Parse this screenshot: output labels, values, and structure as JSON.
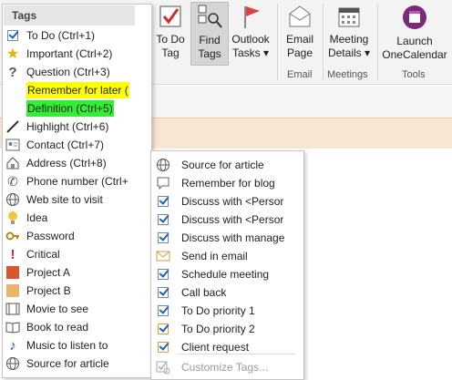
{
  "ribbon": {
    "buttons": [
      {
        "name": "todo-tag-button",
        "label1": "To Do",
        "label2": "Tag",
        "icon": "red-checkbox-icon"
      },
      {
        "name": "find-tags-button",
        "label1": "Find",
        "label2": "Tags",
        "icon": "find-tags-icon"
      },
      {
        "name": "outlook-tasks-button",
        "label1": "Outlook",
        "label2": "Tasks ▾",
        "icon": "red-flag-icon"
      },
      {
        "name": "email-page-button",
        "label1": "Email",
        "label2": "Page",
        "icon": "envelope-icon"
      },
      {
        "name": "meeting-details-button",
        "label1": "Meeting",
        "label2": "Details ▾",
        "icon": "calendar-icon"
      },
      {
        "name": "launch-onecalendar-button",
        "label1": "Launch",
        "label2": "OneCalendar",
        "icon": "onecalendar-icon"
      }
    ],
    "groups": {
      "email": "Email",
      "meetings": "Meetings",
      "tools": "Tools"
    }
  },
  "tags_menu": {
    "header": "Tags",
    "items": [
      {
        "label": "To Do (Ctrl+1)",
        "icon": "checkbox-icon"
      },
      {
        "label": "Important (Ctrl+2)",
        "icon": "star-icon"
      },
      {
        "label": "Question (Ctrl+3)",
        "icon": "question-icon"
      },
      {
        "label": "Remember for later (",
        "icon": "",
        "highlight": "#ffff00"
      },
      {
        "label": "Definition (Ctrl+5)",
        "icon": "",
        "highlight": "#33ee33"
      },
      {
        "label": "Highlight (Ctrl+6)",
        "icon": "pen-icon"
      },
      {
        "label": "Contact (Ctrl+7)",
        "icon": "contact-card-icon"
      },
      {
        "label": "Address (Ctrl+8)",
        "icon": "house-icon"
      },
      {
        "label": "Phone number (Ctrl+",
        "icon": "phone-icon"
      },
      {
        "label": "Web site to visit",
        "icon": "globe-icon"
      },
      {
        "label": "Idea",
        "icon": "lightbulb-icon"
      },
      {
        "label": "Password",
        "icon": "key-icon"
      },
      {
        "label": "Critical",
        "icon": "exclamation-icon"
      },
      {
        "label": "Project A",
        "icon": "red-square-icon"
      },
      {
        "label": "Project B",
        "icon": "tan-square-icon"
      },
      {
        "label": "Movie to see",
        "icon": "film-icon"
      },
      {
        "label": "Book to read",
        "icon": "book-icon"
      },
      {
        "label": "Music to listen to",
        "icon": "music-note-icon"
      },
      {
        "label": "Source for article",
        "icon": "globe-icon"
      }
    ]
  },
  "submenu": {
    "items": [
      {
        "label": "Source for article",
        "icon": "globe-icon"
      },
      {
        "label": "Remember for blog",
        "icon": "speech-bubble-icon"
      },
      {
        "label": "Discuss with <Persor",
        "icon": "person-checkbox-icon"
      },
      {
        "label": "Discuss with <Persor",
        "icon": "person-checkbox-icon"
      },
      {
        "label": "Discuss with manage",
        "icon": "person-checkbox-icon"
      },
      {
        "label": "Send in email",
        "icon": "envelope-icon"
      },
      {
        "label": "Schedule meeting",
        "icon": "calendar-checkbox-icon"
      },
      {
        "label": "Call back",
        "icon": "phone-checkbox-icon"
      },
      {
        "label": "To Do priority 1",
        "icon": "priority-1-icon"
      },
      {
        "label": "To Do priority 2",
        "icon": "priority-2-icon"
      },
      {
        "label": "Client request",
        "icon": "client-checkbox-icon"
      }
    ],
    "customize": "Customize Tags..."
  }
}
